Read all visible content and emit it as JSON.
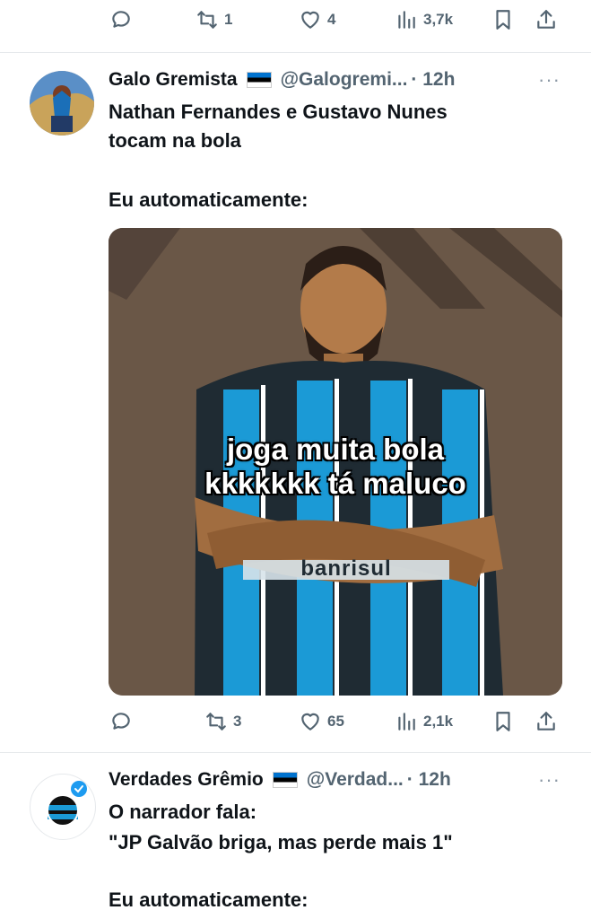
{
  "top_actions": {
    "reply_count": "",
    "retweet_count": "1",
    "like_count": "4",
    "views_count": "3,7k"
  },
  "tweet1": {
    "display_name": "Galo Gremista",
    "handle": "@Galogremi...",
    "time": "· 12h",
    "more": "···",
    "text_line1": "Nathan Fernandes e Gustavo Nunes",
    "text_line2": "tocam na bola",
    "text_line3": "Eu automaticamente:",
    "meme_caption_line1": "joga muita bola",
    "meme_caption_line2": "kkkkkkk tá maluco",
    "shirt_sponsor": "banrisul",
    "actions": {
      "retweet_count": "3",
      "like_count": "65",
      "views_count": "2,1k"
    }
  },
  "tweet2": {
    "display_name": "Verdades Grêmio",
    "handle": "@Verdad...",
    "time": "· 12h",
    "more": "···",
    "text_line1": "O narrador fala:",
    "text_line2": "\"JP Galvão briga, mas perde mais 1\"",
    "text_line3": "Eu automaticamente:"
  },
  "colors": {
    "text": "#0f1419",
    "secondary": "#536471",
    "divider": "#e6e9ec",
    "gremio_blue": "#1b9ad6",
    "verified": "#1d9bf0"
  },
  "icons": [
    "reply-icon",
    "retweet-icon",
    "like-icon",
    "views-icon",
    "bookmark-icon",
    "share-icon",
    "estonia-flag-icon",
    "verified-badge-icon"
  ]
}
